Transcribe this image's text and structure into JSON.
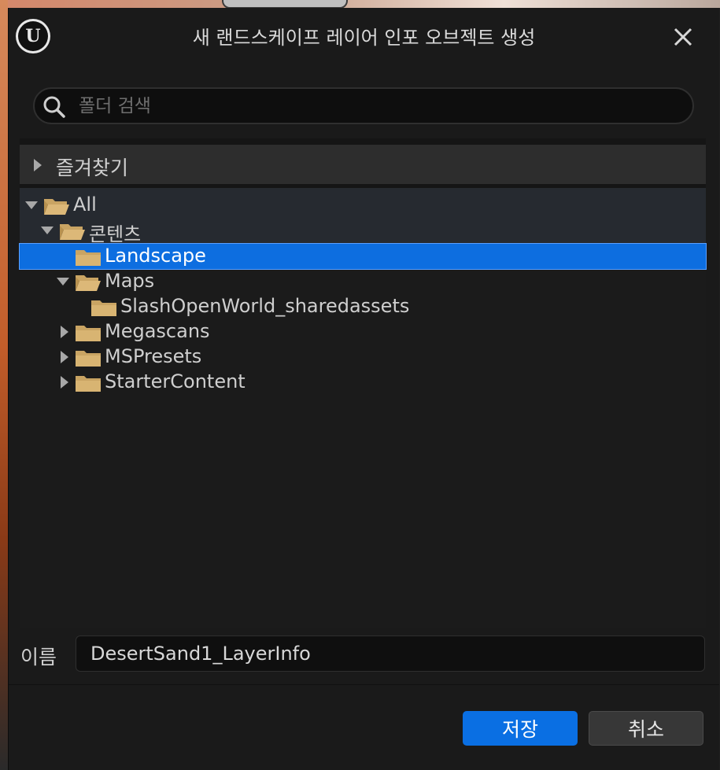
{
  "dialog": {
    "title": "새 랜드스케이프 레이어 인포 오브젝트 생성",
    "logo_text": "U"
  },
  "search": {
    "placeholder": "폴더 검색",
    "value": ""
  },
  "favorites": {
    "label": "즐겨찾기",
    "expanded": false
  },
  "tree": {
    "items": [
      {
        "label": "All",
        "arrow": "expanded",
        "folder": "open",
        "selected": false
      },
      {
        "label": "콘텐츠",
        "arrow": "expanded",
        "folder": "open",
        "selected": false
      },
      {
        "label": "Landscape",
        "arrow": "none",
        "folder": "closed",
        "selected": true
      },
      {
        "label": "Maps",
        "arrow": "expanded",
        "folder": "open",
        "selected": false
      },
      {
        "label": "SlashOpenWorld_sharedassets",
        "arrow": "none",
        "folder": "closed",
        "selected": false
      },
      {
        "label": "Megascans",
        "arrow": "collapsed",
        "folder": "closed",
        "selected": false
      },
      {
        "label": "MSPresets",
        "arrow": "collapsed",
        "folder": "closed",
        "selected": false
      },
      {
        "label": "StarterContent",
        "arrow": "collapsed",
        "folder": "closed",
        "selected": false
      }
    ]
  },
  "name_field": {
    "label": "이름",
    "value": "DesertSand1_LayerInfo"
  },
  "buttons": {
    "save": "저장",
    "cancel": "취소"
  },
  "colors": {
    "selection": "#0d6ee0",
    "folder": "#c9a463",
    "primary_button": "#0a6fe3"
  }
}
